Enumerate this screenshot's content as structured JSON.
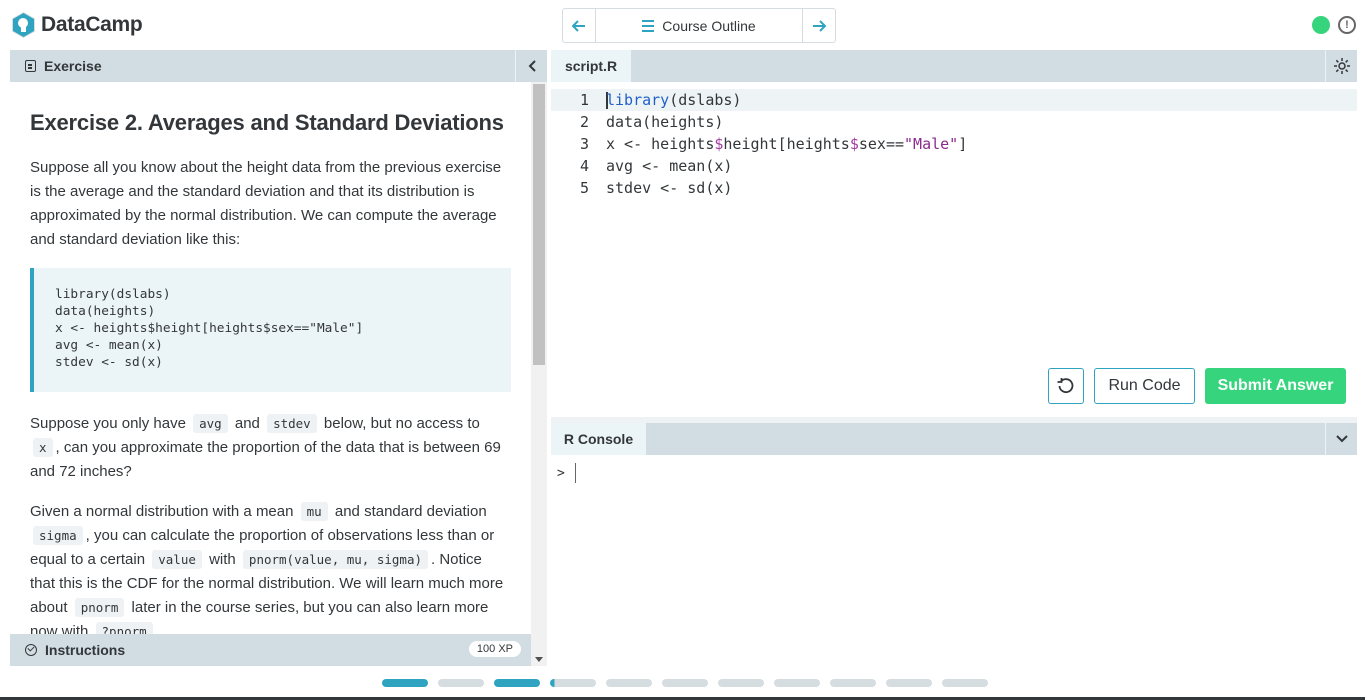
{
  "header": {
    "brand": "DataCamp",
    "nav_label": "Course Outline",
    "status_color": "#36d57d",
    "alert_symbol": "!"
  },
  "exercise_panel": {
    "tab_label": "Exercise",
    "title": "Exercise 2. Averages and Standard Deviations",
    "intro": "Suppose all you know about the height data from the previous exercise is the average and the standard deviation and that its distribution is approximated by the normal distribution. We can compute the average and standard deviation like this:",
    "code_sample": "library(dslabs)\ndata(heights)\nx <- heights$height[heights$sex==\"Male\"]\navg <- mean(x)\nstdev <- sd(x)",
    "p2": {
      "t1": "Suppose you only have",
      "c1": "avg",
      "t2": "and",
      "c2": "stdev",
      "t3": "below, but no access to",
      "c3": "x",
      "t4": ", can you approximate the proportion of the data that is between 69 and 72 inches?"
    },
    "p3": {
      "t1": "Given a normal distribution with a mean",
      "c1": "mu",
      "t2": "and standard deviation",
      "c2": "sigma",
      "t3": ", you can calculate the proportion of observations less than or equal to a certain",
      "c3": "value",
      "t4": "with",
      "c4": "pnorm(value, mu, sigma)",
      "t5": ". Notice that this is the CDF for the normal distribution. We will learn much more about",
      "c5": "pnorm",
      "t6": "later in the course series, but you can also learn more now with",
      "c6": "?pnorm",
      "t7": "."
    },
    "instructions_label": "Instructions",
    "xp": "100 XP"
  },
  "editor": {
    "tab_label": "script.R",
    "lines": [
      {
        "n": "1",
        "parts": [
          {
            "t": "library",
            "c": "fn"
          },
          {
            "t": "(dslabs)",
            "c": "op"
          }
        ]
      },
      {
        "n": "2",
        "parts": [
          {
            "t": "data(heights)",
            "c": "op"
          }
        ]
      },
      {
        "n": "3",
        "parts": [
          {
            "t": "x <- heights",
            "c": "op"
          },
          {
            "t": "$",
            "c": "dollar"
          },
          {
            "t": "height[heights",
            "c": "op"
          },
          {
            "t": "$",
            "c": "dollar"
          },
          {
            "t": "sex==",
            "c": "op"
          },
          {
            "t": "\"Male\"",
            "c": "str"
          },
          {
            "t": "]",
            "c": "op"
          }
        ]
      },
      {
        "n": "4",
        "parts": [
          {
            "t": "avg <- mean(x)",
            "c": "op"
          }
        ]
      },
      {
        "n": "5",
        "parts": [
          {
            "t": "stdev <- sd(x)",
            "c": "op"
          }
        ]
      }
    ],
    "reset_symbol": "↺",
    "run_label": "Run Code",
    "submit_label": "Submit Answer"
  },
  "console": {
    "tab_label": "R Console",
    "prompt": ">"
  },
  "progress": {
    "segments": [
      "done",
      "todo",
      "done",
      "partial",
      "todo",
      "todo",
      "todo",
      "todo",
      "todo",
      "todo",
      "todo"
    ]
  }
}
